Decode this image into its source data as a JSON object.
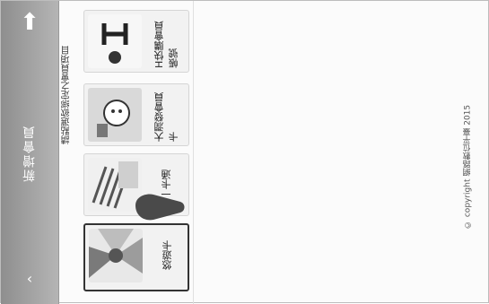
{
  "header": {
    "title": "新增會員",
    "home_icon": "home-icon",
    "back_icon": "back-icon",
    "home_glyph": "⬆",
    "back_glyph": "‹"
  },
  "instruction": "請點選欲綁定之會員項目",
  "cards": [
    {
      "label": "悠遊卡",
      "icon": "easycard-icon"
    },
    {
      "label": "一卡通",
      "icon": "ipass-icon"
    },
    {
      "label": "大潤發會員卡",
      "icon": "rt-mart-icon"
    },
    {
      "label": "H快購會員帳號",
      "icon": "h-buy-icon"
    }
  ],
  "footer": "© copyright 網路數位平臺 2015",
  "colors": {
    "header_bg": "#9e9e9e",
    "selected_border": "#333333"
  }
}
